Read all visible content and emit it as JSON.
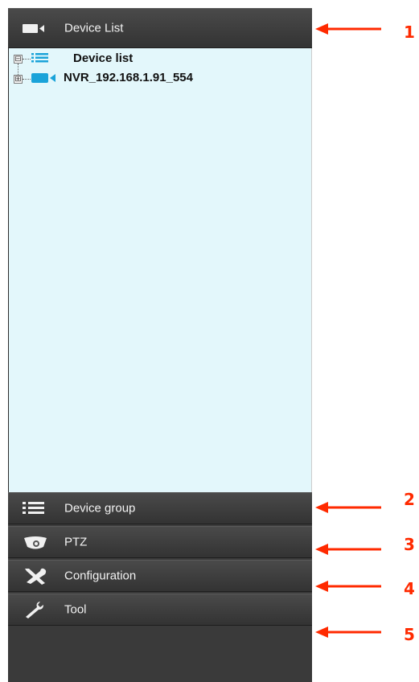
{
  "panel": {
    "header": {
      "label": "Device List",
      "icon": "video-camera-icon"
    },
    "tree": {
      "root": {
        "label": "Device list",
        "expander": "⊟",
        "icon": "list-icon"
      },
      "child": {
        "label": "NVR_192.168.1.91_554",
        "expander": "⊞",
        "icon": "video-camera-icon"
      }
    },
    "sections": [
      {
        "label": "Device group",
        "icon": "list-icon"
      },
      {
        "label": "PTZ",
        "icon": "dome-camera-icon"
      },
      {
        "label": "Configuration",
        "icon": "tools-icon"
      },
      {
        "label": "Tool",
        "icon": "wrench-icon"
      }
    ]
  },
  "callouts": [
    "1",
    "2",
    "3",
    "4",
    "5"
  ],
  "colors": {
    "panel": "#3a3a3a",
    "tree_bg": "#e3f7fb",
    "camera_blue": "#1aa3d9",
    "callout_red": "#ff2a00"
  }
}
